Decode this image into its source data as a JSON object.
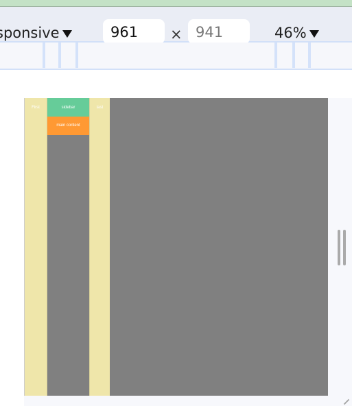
{
  "toolbar": {
    "device_label": "sponsive",
    "width_value": "961",
    "height_value": "941",
    "times": "×",
    "zoom_label": "46%"
  },
  "page": {
    "first": "First",
    "sidebar": "sidebar",
    "main": "main content",
    "last": "last"
  },
  "colors": {
    "first": "#efe6aa",
    "sidebar": "#66cc99",
    "main": "#ff9933",
    "background": "#808080"
  }
}
